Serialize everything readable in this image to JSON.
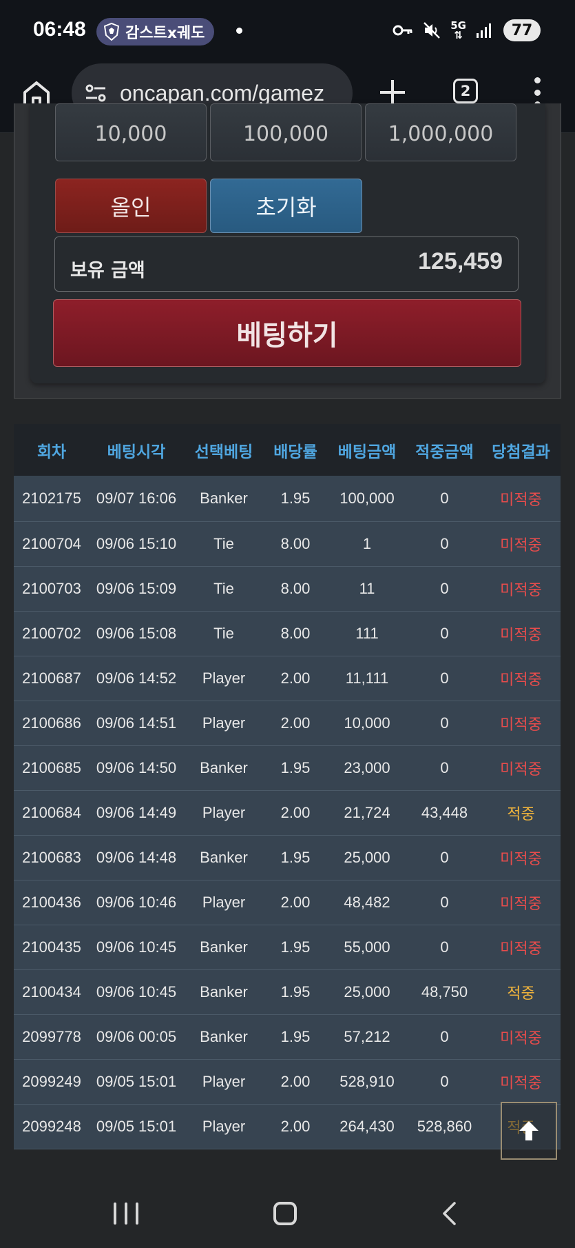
{
  "status_bar": {
    "time": "06:48",
    "notification_pill": "감스트x궤도",
    "network": "5G",
    "battery": "77",
    "icons": [
      "shield-icon",
      "key-icon",
      "mute-icon",
      "signal-icon"
    ]
  },
  "browser": {
    "url": "oncapan.com/gamez",
    "tab_count": "2",
    "icons": [
      "home-icon",
      "site-settings-icon",
      "plus-icon",
      "tabs-icon",
      "menu-icon"
    ]
  },
  "bet_panel": {
    "chips": [
      "10,000",
      "100,000",
      "1,000,000"
    ],
    "allin_label": "올인",
    "reset_label": "초기화",
    "balance_label": "보유 금액",
    "balance_value": "125,459",
    "bet_label": "베팅하기"
  },
  "history": {
    "headers": [
      "회차",
      "베팅시각",
      "선택베팅",
      "배당률",
      "베팅금액",
      "적중금액",
      "당첨결과"
    ],
    "rows": [
      [
        "2102175",
        "09/07 16:06",
        "Banker",
        "1.95",
        "100,000",
        "0",
        "미적중"
      ],
      [
        "2100704",
        "09/06 15:10",
        "Tie",
        "8.00",
        "1",
        "0",
        "미적중"
      ],
      [
        "2100703",
        "09/06 15:09",
        "Tie",
        "8.00",
        "11",
        "0",
        "미적중"
      ],
      [
        "2100702",
        "09/06 15:08",
        "Tie",
        "8.00",
        "111",
        "0",
        "미적중"
      ],
      [
        "2100687",
        "09/06 14:52",
        "Player",
        "2.00",
        "11,111",
        "0",
        "미적중"
      ],
      [
        "2100686",
        "09/06 14:51",
        "Player",
        "2.00",
        "10,000",
        "0",
        "미적중"
      ],
      [
        "2100685",
        "09/06 14:50",
        "Banker",
        "1.95",
        "23,000",
        "0",
        "미적중"
      ],
      [
        "2100684",
        "09/06 14:49",
        "Player",
        "2.00",
        "21,724",
        "43,448",
        "적중"
      ],
      [
        "2100683",
        "09/06 14:48",
        "Banker",
        "1.95",
        "25,000",
        "0",
        "미적중"
      ],
      [
        "2100436",
        "09/06 10:46",
        "Player",
        "2.00",
        "48,482",
        "0",
        "미적중"
      ],
      [
        "2100435",
        "09/06 10:45",
        "Banker",
        "1.95",
        "55,000",
        "0",
        "미적중"
      ],
      [
        "2100434",
        "09/06 10:45",
        "Banker",
        "1.95",
        "25,000",
        "48,750",
        "적중"
      ],
      [
        "2099778",
        "09/06 00:05",
        "Banker",
        "1.95",
        "57,212",
        "0",
        "미적중"
      ],
      [
        "2099249",
        "09/05 15:01",
        "Player",
        "2.00",
        "528,910",
        "0",
        "미적중"
      ],
      [
        "2099248",
        "09/05 15:01",
        "Player",
        "2.00",
        "264,430",
        "528,860",
        "적중"
      ]
    ]
  },
  "colors": {
    "header_text": "#4fa6e0",
    "row_bg": "#374451",
    "lose": "#e74c4c",
    "win": "#f0b43c",
    "allin_button": "#8c2420",
    "reset_button": "#326a94",
    "bet_button": "#8e1e2a"
  },
  "overlay": {
    "scroll_top_icon": "arrow-up-icon"
  },
  "nav_bar": {
    "icons": [
      "recent-apps-icon",
      "home-nav-icon",
      "back-icon"
    ]
  }
}
